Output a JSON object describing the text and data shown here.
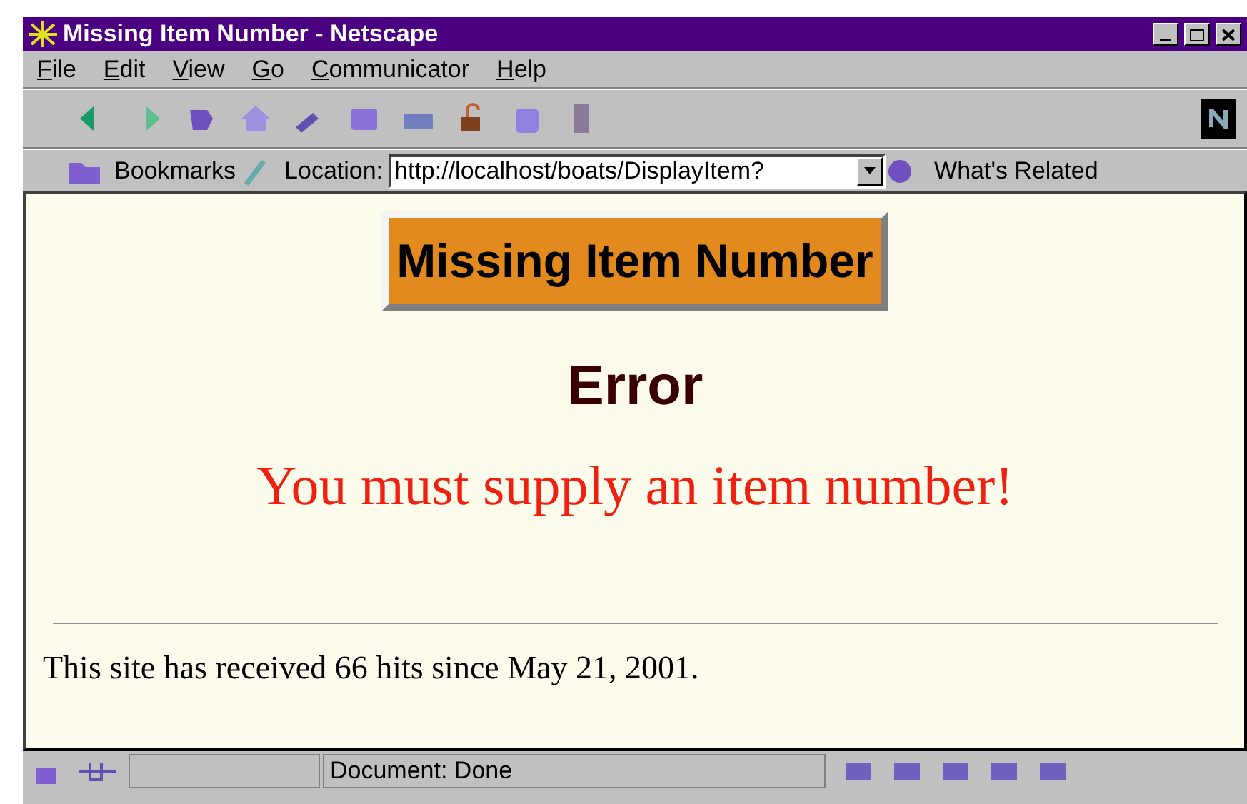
{
  "window": {
    "title": "Missing Item Number - Netscape"
  },
  "menu": [
    "File",
    "Edit",
    "View",
    "Go",
    "Communicator",
    "Help"
  ],
  "location_bar": {
    "bookmarks": "Bookmarks",
    "location_label": "Location:",
    "url": "http://localhost/boats/DisplayItem?",
    "related": "What's Related"
  },
  "page": {
    "banner": "Missing Item Number",
    "heading": "Error",
    "message": "You must supply an item number!",
    "footer": "This site has received 66 hits since May 21, 2001."
  },
  "status_bar": {
    "text": "Document: Done"
  }
}
